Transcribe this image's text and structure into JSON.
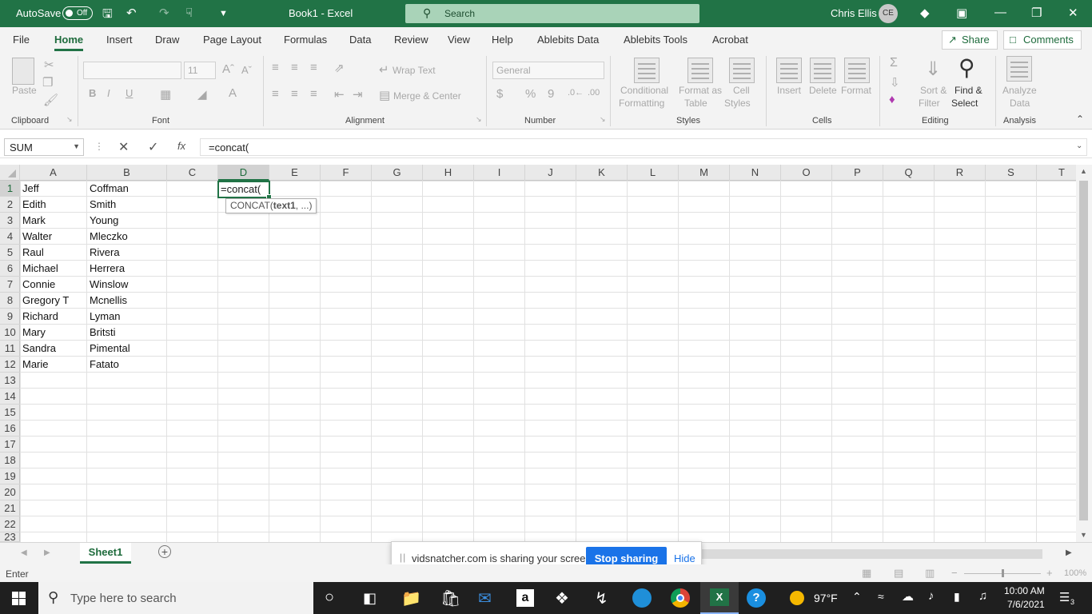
{
  "titlebar": {
    "autosave_label": "AutoSave",
    "autosave_state": "Off",
    "doc_title": "Book1  -  Excel",
    "search_placeholder": "Search",
    "user_name": "Chris Ellis",
    "user_initials": "CE"
  },
  "menu": {
    "tabs": [
      "File",
      "Home",
      "Insert",
      "Draw",
      "Page Layout",
      "Formulas",
      "Data",
      "Review",
      "View",
      "Help",
      "Ablebits Data",
      "Ablebits Tools",
      "Acrobat"
    ],
    "share": "Share",
    "comments": "Comments"
  },
  "ribbon": {
    "paste": "Paste",
    "font_name": "",
    "font_size": "11",
    "wrap_text": "Wrap Text",
    "merge_center": "Merge & Center",
    "number_format": "General",
    "conditional_1": "Conditional",
    "conditional_2": "Formatting",
    "format_table_1": "Format as",
    "format_table_2": "Table",
    "cell_styles_1": "Cell",
    "cell_styles_2": "Styles",
    "insert": "Insert",
    "delete": "Delete",
    "format": "Format",
    "sort_filter_1": "Sort &",
    "sort_filter_2": "Filter",
    "find_select_1": "Find &",
    "find_select_2": "Select",
    "analyze_1": "Analyze",
    "analyze_2": "Data",
    "groups": {
      "clipboard": "Clipboard",
      "font": "Font",
      "alignment": "Alignment",
      "number": "Number",
      "styles": "Styles",
      "cells": "Cells",
      "editing": "Editing",
      "analysis": "Analysis"
    },
    "b": "B",
    "i": "I",
    "u": "U",
    "dollar": "$",
    "percent": "%",
    "comma": "9"
  },
  "formula_bar": {
    "name_box": "SUM",
    "fx": "fx",
    "formula": "=concat("
  },
  "columns": [
    "A",
    "B",
    "C",
    "D",
    "E",
    "F",
    "G",
    "H",
    "I",
    "J",
    "K",
    "L",
    "M",
    "N",
    "O",
    "P",
    "Q",
    "R",
    "S",
    "T"
  ],
  "rows": [
    "1",
    "2",
    "3",
    "4",
    "5",
    "6",
    "7",
    "8",
    "9",
    "10",
    "11",
    "12",
    "13",
    "14",
    "15",
    "16",
    "17",
    "18",
    "19",
    "20",
    "21",
    "22",
    "23"
  ],
  "cells": {
    "first_names": [
      "Jeff",
      "Edith",
      "Mark",
      "Walter",
      "Raul",
      "Michael",
      "Connie",
      "Gregory T",
      "Richard",
      "Mary",
      "Sandra",
      "Marie"
    ],
    "last_names": [
      "Coffman",
      "Smith",
      "Young",
      "Mleczko",
      "Rivera",
      "Herrera",
      "Winslow",
      "Mcnellis",
      "Lyman",
      "Britsti",
      "Pimental",
      "Fatato"
    ],
    "active_cell_value": "=concat(",
    "tooltip_fn": "CONCAT(",
    "tooltip_arg": "text1",
    "tooltip_rest": ", ...)"
  },
  "sheet_tabs": {
    "active": "Sheet1"
  },
  "screen_share": {
    "message": "vidsnatcher.com is sharing your screen.",
    "stop": "Stop sharing",
    "hide": "Hide"
  },
  "status": {
    "mode": "Enter",
    "zoom": "100%"
  },
  "taskbar": {
    "search_placeholder": "Type here to search",
    "weather": "97°F",
    "time": "10:00 AM",
    "date": "7/6/2021",
    "notifications": "3"
  },
  "colors": {
    "excel_green": "#217346",
    "share_blue": "#1a73e8"
  }
}
